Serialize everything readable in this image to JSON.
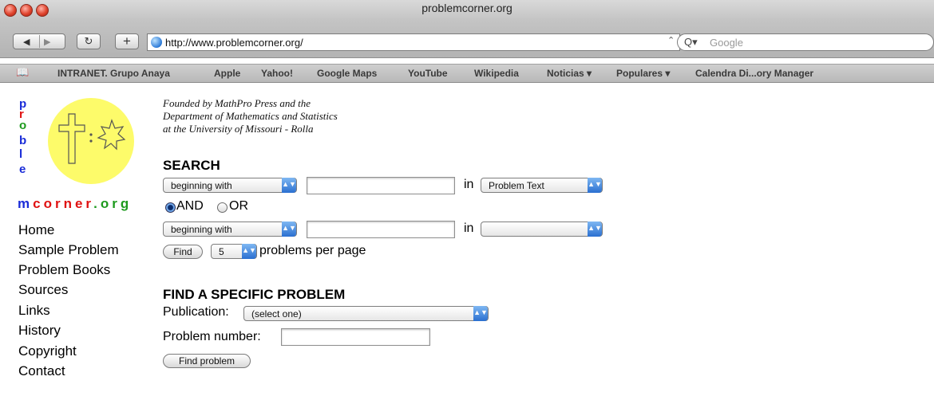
{
  "window": {
    "title": "problemcorner.org",
    "url": "http://www.problemcorner.org/",
    "search_placeholder": "Google"
  },
  "bookmarks": [
    "INTRANET. Grupo Anaya",
    "Apple",
    "Yahoo!",
    "Google Maps",
    "YouTube",
    "Wikipedia",
    "Noticias ▾",
    "Populares ▾",
    "Calendra Di...ory Manager"
  ],
  "logo": {
    "vertical_letters": [
      "p",
      "r",
      "o",
      "b",
      "l",
      "e"
    ],
    "word_parts": [
      "m",
      "corner",
      ".",
      "org"
    ],
    "colors": {
      "blue": "#1a2cd8",
      "red": "#e01212",
      "green": "#1d9a1d",
      "yellow": "#fdfb6a"
    }
  },
  "nav": [
    "Home",
    "Sample Problem",
    "Problem Books",
    "Sources",
    "Links",
    "History",
    "Copyright",
    "Contact"
  ],
  "founded_lines": [
    "Founded by MathPro Press and the",
    "Department of Mathematics and Statistics",
    "at the University of Missouri - Rolla"
  ],
  "search": {
    "heading": "SEARCH",
    "match1": "beginning with",
    "in_label": "in",
    "field1": "Problem Text",
    "and_label": "AND",
    "or_label": "OR",
    "match2": "beginning with",
    "field2": "",
    "find_button": "Find",
    "per_page_value": "5",
    "per_page_label": "problems per page"
  },
  "specific": {
    "heading": "FIND A SPECIFIC PROBLEM",
    "publication_label": "Publication:",
    "publication_value": "(select one)",
    "number_label": "Problem number:",
    "button": "Find problem"
  }
}
